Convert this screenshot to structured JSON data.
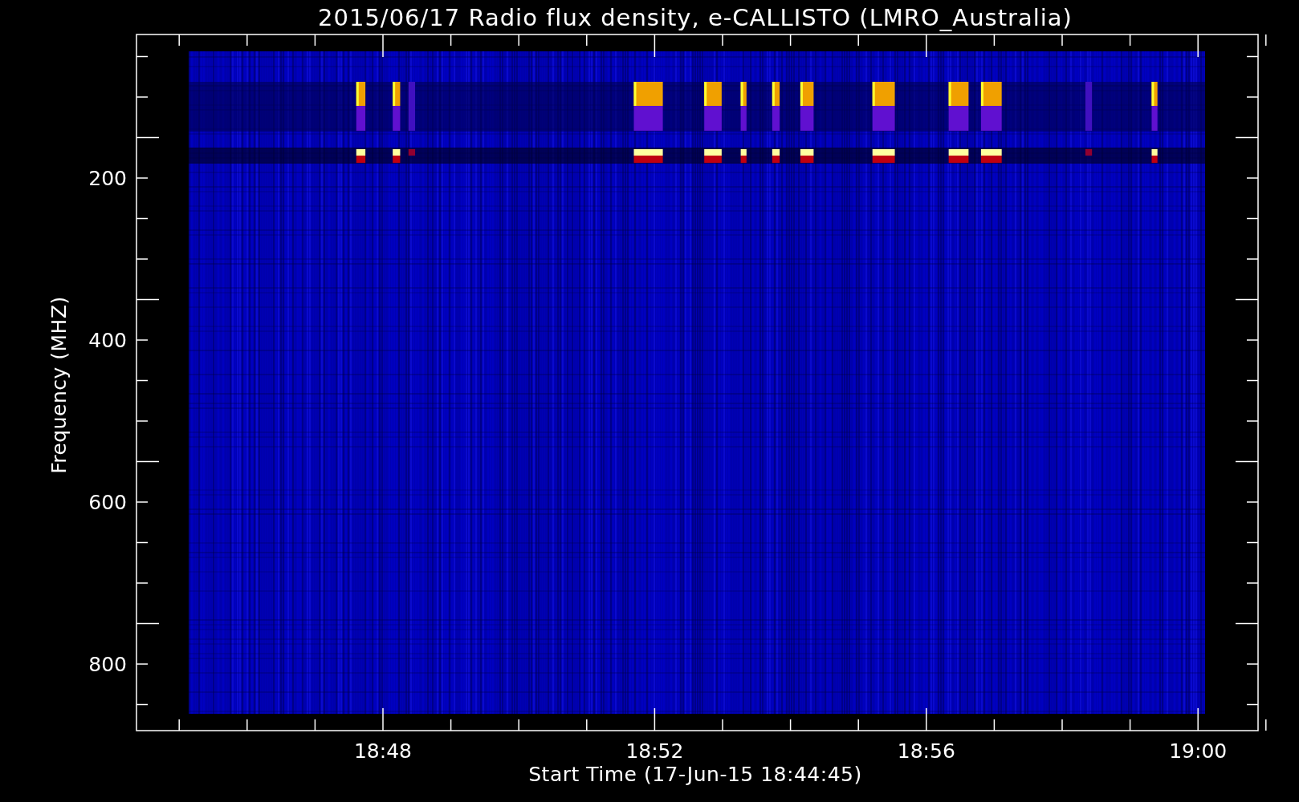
{
  "title": "2015/06/17  Radio flux density, e-CALLISTO (LMRO_Australia)",
  "y_axis": {
    "label": "Frequency (MHZ)",
    "tick_labels": [
      "200",
      "400",
      "600",
      "800"
    ]
  },
  "x_axis": {
    "label": "Start Time (17-Jun-15 18:44:45)",
    "tick_labels": [
      "18:48",
      "18:52",
      "18:56",
      "19:00"
    ]
  }
}
